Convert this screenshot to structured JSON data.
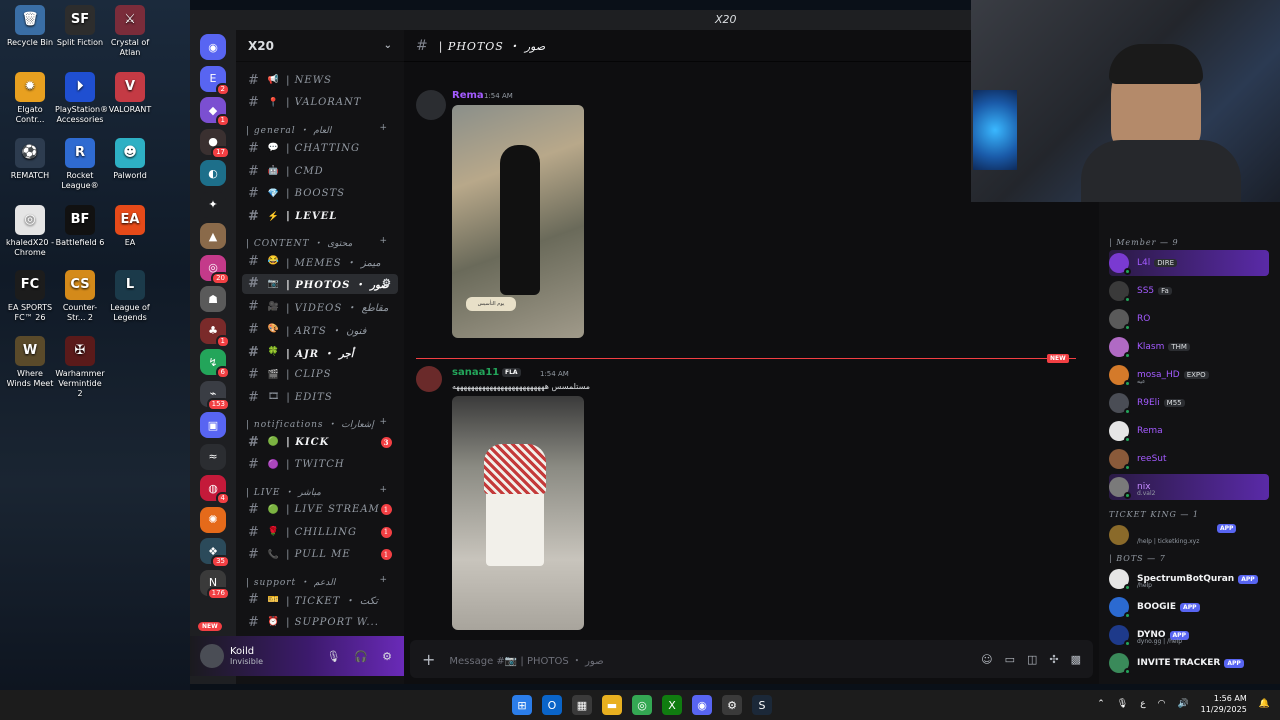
{
  "desktop": {
    "icons": [
      {
        "label": "Recycle Bin",
        "glyph": "🗑",
        "color": "#3a6ea5"
      },
      {
        "label": "Split Fiction",
        "glyph": "SF",
        "color": "#2d2d2d"
      },
      {
        "label": "Crystal of Atlan",
        "glyph": "⚔",
        "color": "#7a2c3a"
      },
      {
        "label": "Elgato Contr...",
        "glyph": "✹",
        "color": "#e8a020"
      },
      {
        "label": "PlayStation® Accessories",
        "glyph": "⏵",
        "color": "#1f4fd1"
      },
      {
        "label": "VALORANT",
        "glyph": "V",
        "color": "#c43a44"
      },
      {
        "label": "REMATCH",
        "glyph": "⚽",
        "color": "#2d3c4f"
      },
      {
        "label": "Rocket League®",
        "glyph": "R",
        "color": "#2f6bd1"
      },
      {
        "label": "Palworld",
        "glyph": "☻",
        "color": "#2eb0c4"
      },
      {
        "label": "khaledX20 - Chrome",
        "glyph": "◎",
        "color": "#e5e5e5"
      },
      {
        "label": "Battlefield 6",
        "glyph": "BF",
        "color": "#111111"
      },
      {
        "label": "EA",
        "glyph": "EA",
        "color": "#e64a19"
      },
      {
        "label": "EA SPORTS FC™ 26",
        "glyph": "FC",
        "color": "#1c1c1c"
      },
      {
        "label": "Counter-Str... 2",
        "glyph": "CS",
        "color": "#d48a1a"
      },
      {
        "label": "League of Legends",
        "glyph": "L",
        "color": "#1b3a4a"
      },
      {
        "label": "Where Winds Meet",
        "glyph": "W",
        "color": "#5a4a2a"
      },
      {
        "label": "Warhammer Vermintide 2",
        "glyph": "✠",
        "color": "#5a1a1a"
      }
    ]
  },
  "window": {
    "title": "X20"
  },
  "guilds": [
    {
      "glyph": "◉",
      "color": "#5865f2",
      "badge": ""
    },
    {
      "glyph": "E",
      "color": "#5865f2",
      "badge": "2"
    },
    {
      "glyph": "◆",
      "color": "#7b4fd1",
      "badge": "1"
    },
    {
      "glyph": "●",
      "color": "#3a3030",
      "badge": "17"
    },
    {
      "glyph": "◐",
      "color": "#1d6f8a",
      "badge": ""
    },
    {
      "glyph": "✦",
      "color": "#1e1f22",
      "badge": ""
    },
    {
      "glyph": "▲",
      "color": "#8a6a4a",
      "badge": ""
    },
    {
      "glyph": "◎",
      "color": "#c43a8a",
      "badge": "20"
    },
    {
      "glyph": "☗",
      "color": "#5a5a5a",
      "badge": ""
    },
    {
      "glyph": "♣",
      "color": "#7a2a2a",
      "badge": "1"
    },
    {
      "glyph": "↯",
      "color": "#23a55a",
      "badge": "6"
    },
    {
      "glyph": "⌁",
      "color": "#3a3d44",
      "badge": "153"
    },
    {
      "glyph": "▣",
      "color": "#5865f2",
      "badge": ""
    },
    {
      "glyph": "≈",
      "color": "#2b2d31",
      "badge": ""
    },
    {
      "glyph": "◍",
      "color": "#c41a3a",
      "badge": "4"
    },
    {
      "glyph": "✺",
      "color": "#e56a1a",
      "badge": ""
    },
    {
      "glyph": "❖",
      "color": "#2b4a5a",
      "badge": "35"
    },
    {
      "glyph": "N",
      "color": "#3a3a3a",
      "badge": "176"
    }
  ],
  "new_label": "NEW",
  "server": {
    "name": "X20",
    "channels_top": [
      {
        "emoji": "📢",
        "name": "| NEWS"
      },
      {
        "emoji": "📍",
        "name": "| VALORANT"
      }
    ],
    "categories": [
      {
        "label": "| general ・ العام",
        "channels": [
          {
            "emoji": "💬",
            "name": "| CHATTING",
            "badge": ""
          },
          {
            "emoji": "🤖",
            "name": "| CMD",
            "badge": ""
          },
          {
            "emoji": "💎",
            "name": "| BOOSTS",
            "badge": ""
          },
          {
            "emoji": "⚡",
            "name": "| LEVEL",
            "badge": "",
            "unread": true
          }
        ]
      },
      {
        "label": "| CONTENT ・ محتوى",
        "channels": [
          {
            "emoji": "😂",
            "name": "| MEMES ・ ميمز",
            "badge": ""
          },
          {
            "emoji": "📷",
            "name": "| PHOTOS ・ صور",
            "badge": "",
            "active": true
          },
          {
            "emoji": "🎥",
            "name": "| VIDEOS ・ مقاطع",
            "badge": ""
          },
          {
            "emoji": "🎨",
            "name": "| ARTS ・ فنون",
            "badge": ""
          },
          {
            "emoji": "🍀",
            "name": "| AJR ・ أجر",
            "badge": "",
            "unread": true
          },
          {
            "emoji": "🎬",
            "name": "| CLIPS",
            "badge": ""
          },
          {
            "emoji": "🎞",
            "name": "| EDITS",
            "badge": ""
          }
        ]
      },
      {
        "label": "| notifications ・ إشعارات",
        "channels": [
          {
            "emoji": "🟢",
            "name": "| KICK",
            "badge": "3",
            "unread": true
          },
          {
            "emoji": "🟣",
            "name": "| TWITCH",
            "badge": ""
          }
        ]
      },
      {
        "label": "| LIVE ・ مباشر",
        "channels": [
          {
            "emoji": "🟢",
            "name": "| LIVE STREAM",
            "badge": "1"
          },
          {
            "emoji": "🌹",
            "name": "| CHILLING",
            "badge": "1"
          },
          {
            "emoji": "📞",
            "name": "| PULL ME",
            "badge": "1"
          }
        ]
      },
      {
        "label": "| support ・ الدعم",
        "channels": [
          {
            "emoji": "🎫",
            "name": "| TICKET ・ تكت",
            "badge": ""
          },
          {
            "emoji": "⏰",
            "name": "| SUPPORT W...",
            "badge": ""
          }
        ]
      }
    ]
  },
  "user": {
    "name": "Koild",
    "status": "Invisible"
  },
  "chat": {
    "channel": "| PHOTOS ・ صور",
    "messages": [
      {
        "author": "Rema",
        "time": "1:54 AM",
        "color": "#a35bff",
        "text": "",
        "photo_caption": "يوم التأسيس"
      },
      {
        "author": "sanaa11",
        "tag": "FLA",
        "time": "1:54 AM",
        "color": "#23a55a",
        "text": "مستلمسس هههههههههههههههههههههههههه"
      }
    ],
    "new_label": "NEW",
    "composer_placeholder": "Message #📷 | PHOTOS ・ صور"
  },
  "members": {
    "group_member": "| Member — 9",
    "list": [
      {
        "name": "L4l",
        "tag": "DIRE",
        "color": "#a35bff",
        "av": "#7a3ad1",
        "sub": ""
      },
      {
        "name": "SS5",
        "tag": "Fa",
        "color": "#a35bff",
        "av": "#3a3a3a",
        "sub": ""
      },
      {
        "name": "RO",
        "tag": "",
        "color": "#a35bff",
        "av": "#5a5a5a",
        "sub": ""
      },
      {
        "name": "Klasm",
        "tag": "THM",
        "color": "#a35bff",
        "av": "#b06ac4",
        "sub": ""
      },
      {
        "name": "mosa_HD",
        "tag": "EXPO",
        "color": "#a35bff",
        "av": "#d47a2a",
        "sub": "عيه"
      },
      {
        "name": "R9Eli",
        "tag": "M55",
        "color": "#a35bff",
        "av": "#4a4d55",
        "sub": ""
      },
      {
        "name": "Rema",
        "tag": "",
        "color": "#a35bff",
        "av": "#e5e5e5",
        "sub": ""
      },
      {
        "name": "reeSut",
        "tag": "",
        "color": "#a35bff",
        "av": "#8a5a3a",
        "sub": ""
      },
      {
        "name": "nix",
        "tag": "",
        "color": "#c48aff",
        "av": "#7a7a7a",
        "sub": "d.val2"
      }
    ],
    "group_ticket": "TICKET KING — 1",
    "ticket_bot": {
      "name": "",
      "sub": "/help | ticketking.xyz",
      "tag": "APP"
    },
    "group_bots": "| BOTS — 7",
    "bots": [
      {
        "name": "SpectrumBotQuran",
        "sub": "/help",
        "tag": "APP",
        "av": "#e5e5e5"
      },
      {
        "name": "BOOGIE",
        "sub": "",
        "tag": "APP",
        "av": "#2b6ad1"
      },
      {
        "name": "DYNO",
        "sub": "dyno.gg | /help",
        "tag": "APP",
        "av": "#1e3a8a"
      },
      {
        "name": "INVITE TRACKER",
        "sub": "",
        "tag": "APP",
        "av": "#3a8a5a"
      }
    ]
  },
  "taskbar": {
    "icons": [
      {
        "glyph": "⊞",
        "color": "#2b7de9"
      },
      {
        "glyph": "O",
        "color": "#0a64c8"
      },
      {
        "glyph": "▦",
        "color": "#3a3a3a"
      },
      {
        "glyph": "▬",
        "color": "#e8b020"
      },
      {
        "glyph": "◎",
        "color": "#34a853"
      },
      {
        "glyph": "X",
        "color": "#107c10"
      },
      {
        "glyph": "◉",
        "color": "#5865f2"
      },
      {
        "glyph": "⚙",
        "color": "#3a3a3a"
      },
      {
        "glyph": "S",
        "color": "#1b2838"
      }
    ],
    "lang": "ع",
    "time": "1:56 AM",
    "date": "11/29/2025"
  }
}
